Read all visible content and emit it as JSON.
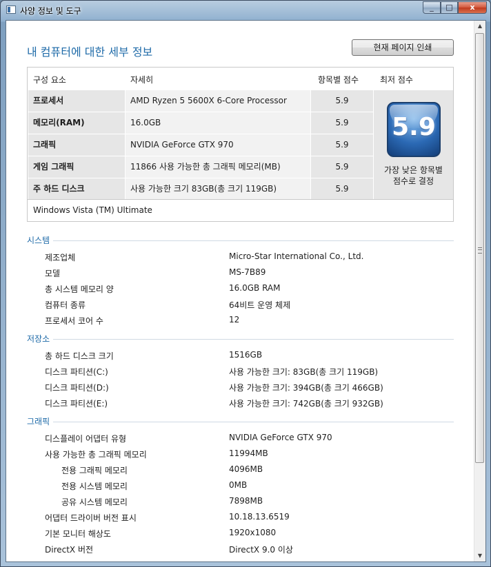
{
  "window": {
    "title": "사양 정보 및 도구",
    "minimize": "_",
    "maximize": "□",
    "close": "x"
  },
  "header": {
    "title": "내 컴퓨터에 대한 세부 정보",
    "print_button": "현재 페이지 인쇄"
  },
  "score_table": {
    "columns": {
      "component": "구성 요소",
      "details": "자세히",
      "subscore": "항목별 점수",
      "base": "최저 점수"
    },
    "rows": [
      {
        "component": "프로세서",
        "details": "AMD Ryzen 5 5600X 6-Core Processor",
        "score": "5.9"
      },
      {
        "component": "메모리(RAM)",
        "details": "16.0GB",
        "score": "5.9"
      },
      {
        "component": "그래픽",
        "details": "NVIDIA GeForce GTX 970",
        "score": "5.9"
      },
      {
        "component": "게임 그래픽",
        "details": "11866 사용 가능한 총 그래픽 메모리(MB)",
        "score": "5.9"
      },
      {
        "component": "주 하드 디스크",
        "details": "사용 가능한 크기 83GB(총 크기 119GB)",
        "score": "5.9"
      }
    ],
    "base_score": "5.9",
    "base_note_line1": "가장 낮은 항목별",
    "base_note_line2": "점수로 결정",
    "os": "Windows Vista (TM) Ultimate"
  },
  "system": {
    "heading": "시스템",
    "items": [
      {
        "label": "제조업체",
        "value": "Micro-Star International Co., Ltd."
      },
      {
        "label": "모델",
        "value": "MS-7B89"
      },
      {
        "label": "총 시스템 메모리 양",
        "value": "16.0GB RAM"
      },
      {
        "label": "컴퓨터 종류",
        "value": "64비트 운영 체제"
      },
      {
        "label": "프로세서 코어 수",
        "value": "12"
      }
    ]
  },
  "storage": {
    "heading": "저장소",
    "items": [
      {
        "label": "총 하드 디스크 크기",
        "value": "1516GB"
      },
      {
        "label": "디스크 파티션(C:)",
        "value": "사용 가능한 크기: 83GB(총 크기 119GB)"
      },
      {
        "label": "디스크 파티션(D:)",
        "value": "사용 가능한 크기: 394GB(총 크기 466GB)"
      },
      {
        "label": "디스크 파티션(E:)",
        "value": "사용 가능한 크기: 742GB(총 크기 932GB)"
      }
    ]
  },
  "graphics": {
    "heading": "그래픽",
    "items": [
      {
        "label": "디스플레이 어댑터 유형",
        "value": "NVIDIA GeForce GTX 970"
      },
      {
        "label": "사용 가능한 총 그래픽 메모리",
        "value": "11994MB"
      },
      {
        "label": "전용 그래픽 메모리",
        "value": "4096MB"
      },
      {
        "label": "전용 시스템 메모리",
        "value": "0MB"
      },
      {
        "label": "공유 시스템 메모리",
        "value": "7898MB"
      },
      {
        "label": "어댑터 드라이버 버전 표시",
        "value": "10.18.13.6519"
      },
      {
        "label": "기본 모니터 해상도",
        "value": "1920x1080"
      },
      {
        "label": "DirectX 버전",
        "value": "DirectX 9.0 이상"
      }
    ]
  },
  "scrollbar": {
    "up": "▲",
    "down": "▼"
  }
}
